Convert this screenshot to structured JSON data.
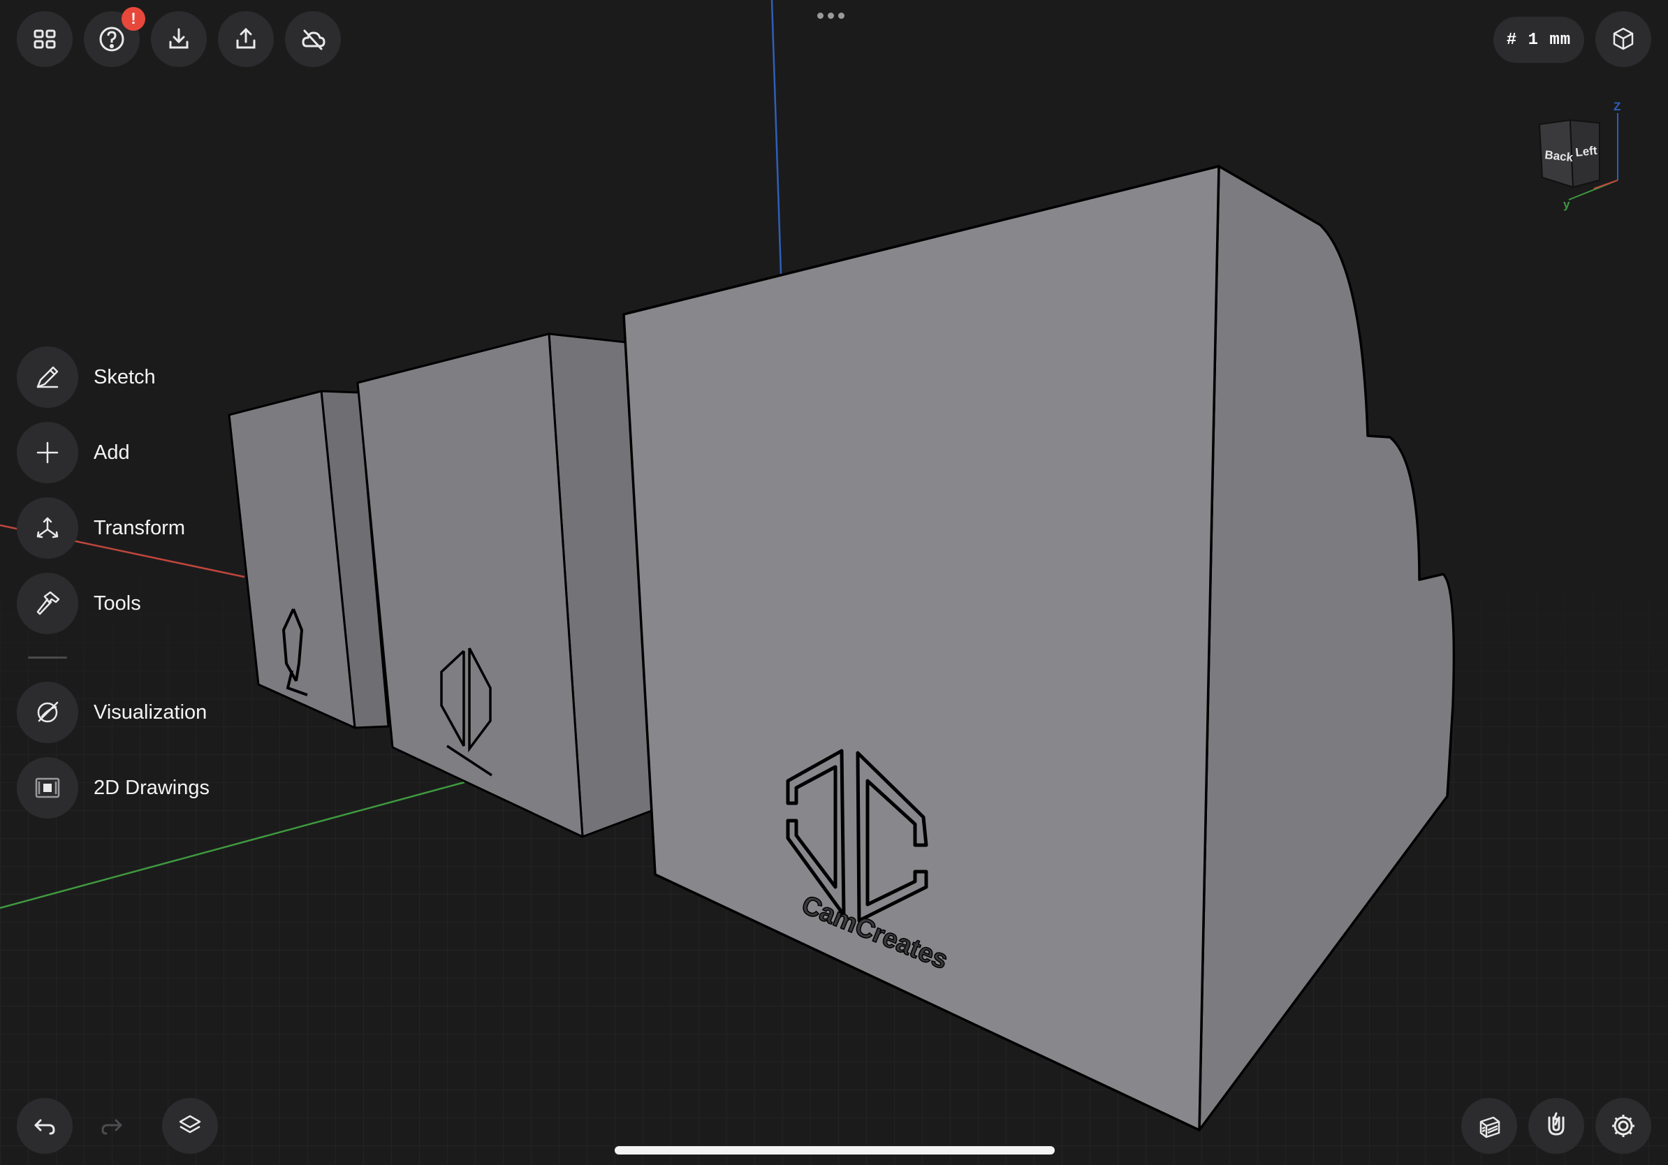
{
  "top_toolbar": {
    "grid_icon": "grid-icon",
    "help_icon": "question-icon",
    "help_badge": "!",
    "import_icon": "import-icon",
    "export_icon": "export-icon",
    "cloud_icon": "cloud-icon"
  },
  "grid_size": {
    "label": "# 1 mm"
  },
  "view_cube": {
    "face_back": "Back",
    "face_left": "Left",
    "axis_z": "Z",
    "axis_y": "y"
  },
  "tools": [
    {
      "label": "Sketch",
      "icon": "sketch-pen-icon"
    },
    {
      "label": "Add",
      "icon": "plus-icon"
    },
    {
      "label": "Transform",
      "icon": "transform-icon"
    },
    {
      "label": "Tools",
      "icon": "hammer-icon"
    },
    {
      "label": "Visualization",
      "icon": "visualization-icon"
    },
    {
      "label": "2D Drawings",
      "icon": "drawing-sheet-icon"
    }
  ],
  "model": {
    "engraving_text": "CamCreates"
  },
  "bottom_toolbar": {
    "undo": "undo-icon",
    "redo": "redo-icon",
    "layers": "layers-icon",
    "section": "section-view-icon",
    "snap": "magnet-icon",
    "settings": "gear-icon"
  },
  "colors": {
    "background": "#1b1b1c",
    "model_face": "#8a8a8e",
    "axis_x": "#c0463c",
    "axis_y": "#3f9a3f",
    "axis_z": "#2f5fb8",
    "badge": "#e8483b"
  }
}
